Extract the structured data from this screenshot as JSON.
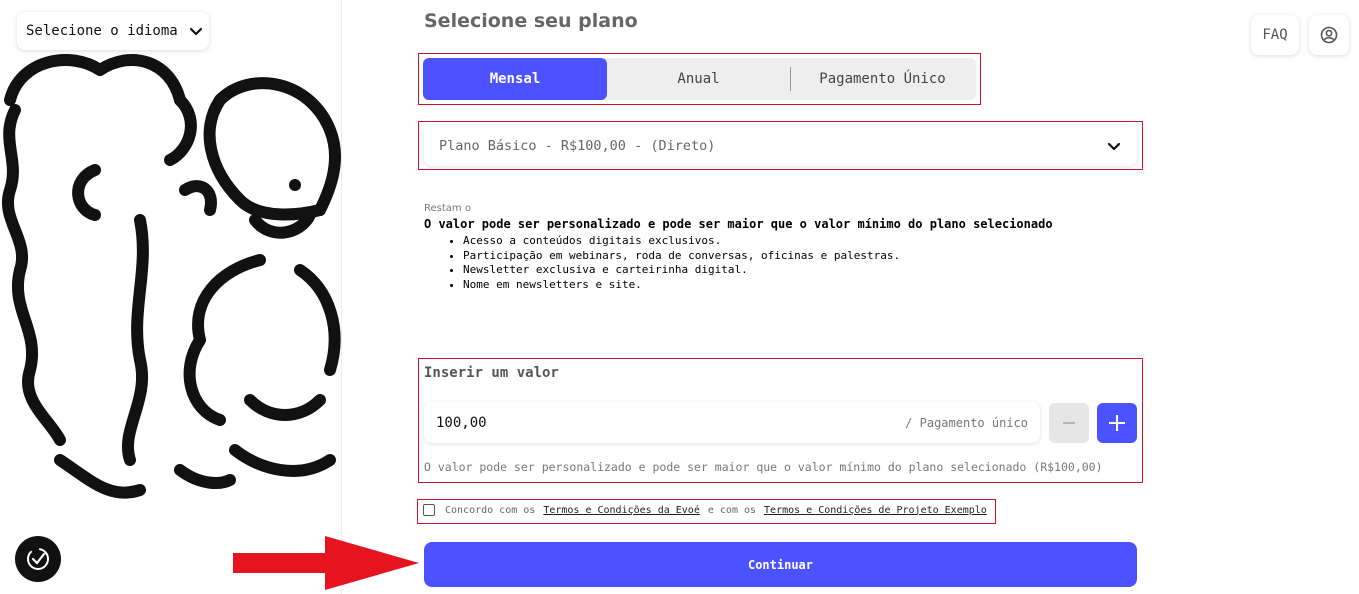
{
  "language_selector": {
    "label": "Selecione o idioma"
  },
  "header": {
    "faq_label": "FAQ"
  },
  "plan_section": {
    "heading": "Selecione seu plano",
    "tabs": [
      {
        "label": "Mensal",
        "active": true
      },
      {
        "label": "Anual",
        "active": false
      },
      {
        "label": "Pagamento Único",
        "active": false
      }
    ],
    "selected_plan": "Plano Básico - R$100,00 - (Direto)"
  },
  "plan_details": {
    "remaining": "Restam o",
    "description": "O valor pode ser personalizado e pode ser maior que o valor mínimo do plano selecionado",
    "benefits": [
      "Acesso a conteúdos digitais exclusivos.",
      "Participação em webinars, roda de conversas, oficinas e palestras.",
      "Newsletter exclusiva e carteirinha digital.",
      "Nome em newsletters e site."
    ]
  },
  "value_section": {
    "label": "Inserir um valor",
    "value": "100,00",
    "unit": "/ Pagamento único",
    "help": "O valor pode ser personalizado e pode ser maior que o valor mínimo do plano selecionado (R$100,00)"
  },
  "terms": {
    "prefix": "Concordo com os",
    "link1": "Termos e Condições da Evoé",
    "middle": "e com os",
    "link2": "Termos e Condições de Projeto Exemplo"
  },
  "actions": {
    "continue_label": "Continuar"
  },
  "colors": {
    "accent": "#4d52ff",
    "highlight_border": "#c9142b",
    "arrow": "#e5141e"
  }
}
